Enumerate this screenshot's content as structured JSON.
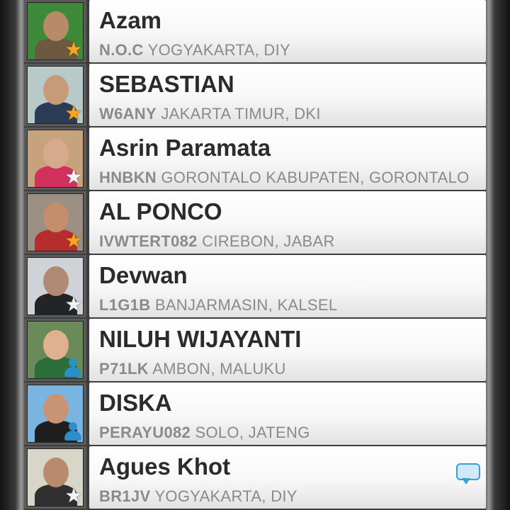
{
  "contacts": [
    {
      "name": "",
      "code": "",
      "location": ",",
      "badge": "star-gold",
      "avatar_colors": [
        "#5f7f9a",
        "#c9a27e",
        "#445566"
      ]
    },
    {
      "name": "Azam",
      "code": "N.O.C",
      "location": "YOGYAKARTA, DIY",
      "badge": "star-gold",
      "avatar_colors": [
        "#3f8a3a",
        "#b88a6a",
        "#6b5a40"
      ]
    },
    {
      "name": "SEBASTIAN",
      "code": "W6ANY",
      "location": "JAKARTA TIMUR, DKI",
      "badge": "star-gold",
      "avatar_colors": [
        "#b7c9c9",
        "#c79a78",
        "#2d3c56"
      ]
    },
    {
      "name": "Asrin Paramata",
      "code": "HNBKN",
      "location": "GORONTALO KABUPATEN, GORONTALO",
      "badge": "star-white",
      "avatar_colors": [
        "#c7a37d",
        "#d7aa8c",
        "#d2315f"
      ]
    },
    {
      "name": "AL PONCO",
      "code": "IVWTERT082",
      "location": "CIREBON, JABAR",
      "badge": "star-gold",
      "avatar_colors": [
        "#9c8f83",
        "#c48e6c",
        "#b62d2d"
      ]
    },
    {
      "name": "Devwan",
      "code": "L1G1B",
      "location": "BANJARMASIN, KALSEL",
      "badge": "star-white",
      "avatar_colors": [
        "#cfd2d6",
        "#b08a75",
        "#222428"
      ]
    },
    {
      "name": "NILUH WIJAYANTI",
      "code": "P71LK",
      "location": "AMBON, MALUKU",
      "badge": "person",
      "avatar_colors": [
        "#6a8a5a",
        "#e0b08f",
        "#2b6d3b"
      ]
    },
    {
      "name": "DISKA",
      "code": "PERAYU082",
      "location": "SOLO, JATENG",
      "badge": "person",
      "avatar_colors": [
        "#7ab4e0",
        "#c99473",
        "#1e1e1e"
      ]
    },
    {
      "name": "Agues Khot",
      "code": "BR1JV",
      "location": "YOGYAKARTA, DIY",
      "badge": "star-white",
      "avatar_colors": [
        "#d8d5c9",
        "#b98a6d",
        "#2f2f2f"
      ],
      "chat": true
    }
  ],
  "icons": {
    "star": "★",
    "person": "person-icon",
    "chat": "chat-bubble-icon"
  }
}
